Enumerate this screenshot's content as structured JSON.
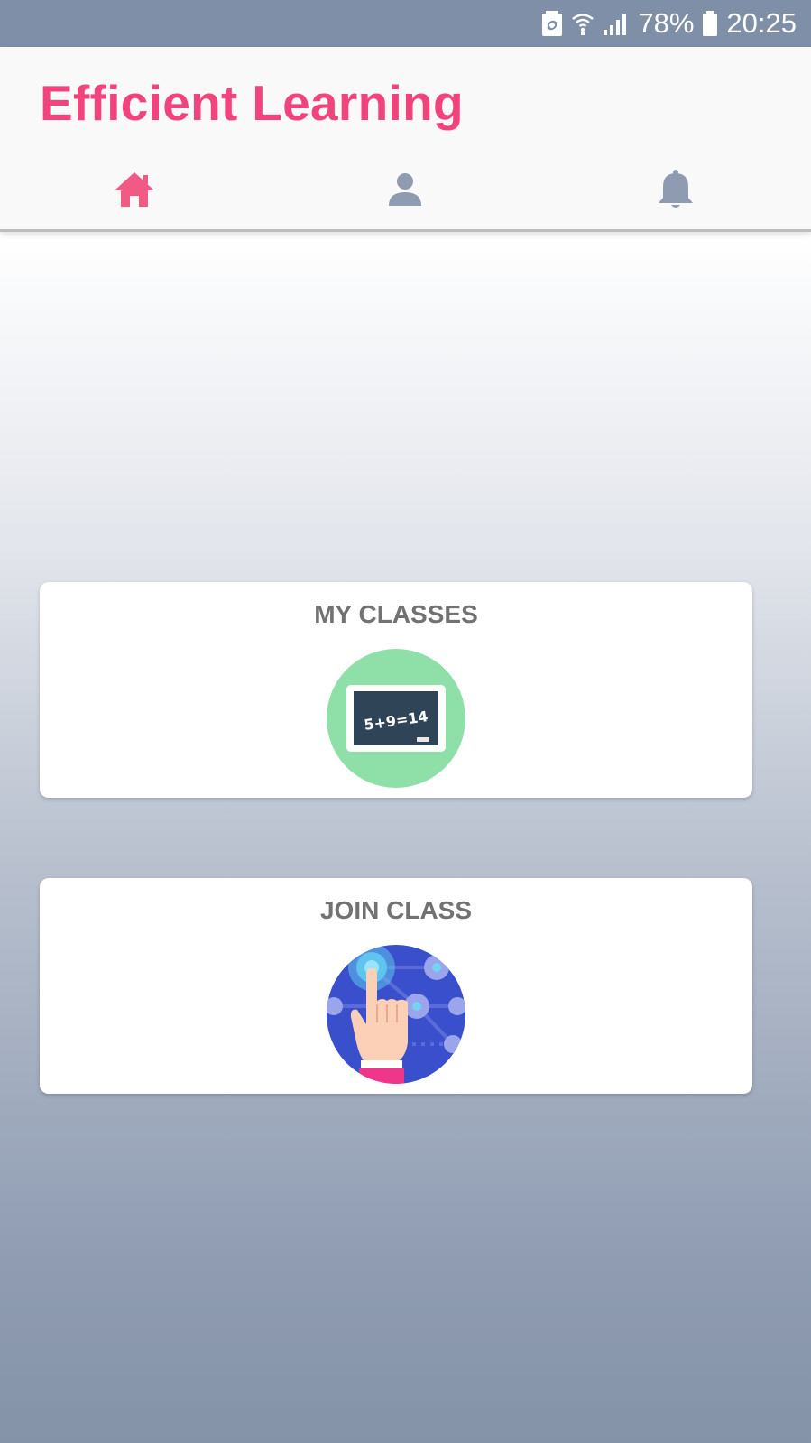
{
  "status_bar": {
    "battery_percent": "78%",
    "time": "20:25",
    "icons": [
      "battery-saver-icon",
      "wifi-icon",
      "signal-icon",
      "battery-icon"
    ]
  },
  "app": {
    "title": "Efficient Learning",
    "brand_color": "#f1437c"
  },
  "nav": {
    "tabs": [
      {
        "icon": "home-icon",
        "active": true,
        "color": "#f05a84"
      },
      {
        "icon": "person-icon",
        "active": false,
        "color": "#8e9bb1"
      },
      {
        "icon": "bell-icon",
        "active": false,
        "color": "#8e9bb1"
      }
    ]
  },
  "cards": [
    {
      "title": "MY CLASSES",
      "icon": "chalkboard-icon",
      "chalkboard_text": "5+9=14",
      "icon_bg": "#8fdfa9"
    },
    {
      "title": "JOIN CLASS",
      "icon": "touch-network-icon",
      "icon_bg": "#3a4fcb"
    }
  ]
}
